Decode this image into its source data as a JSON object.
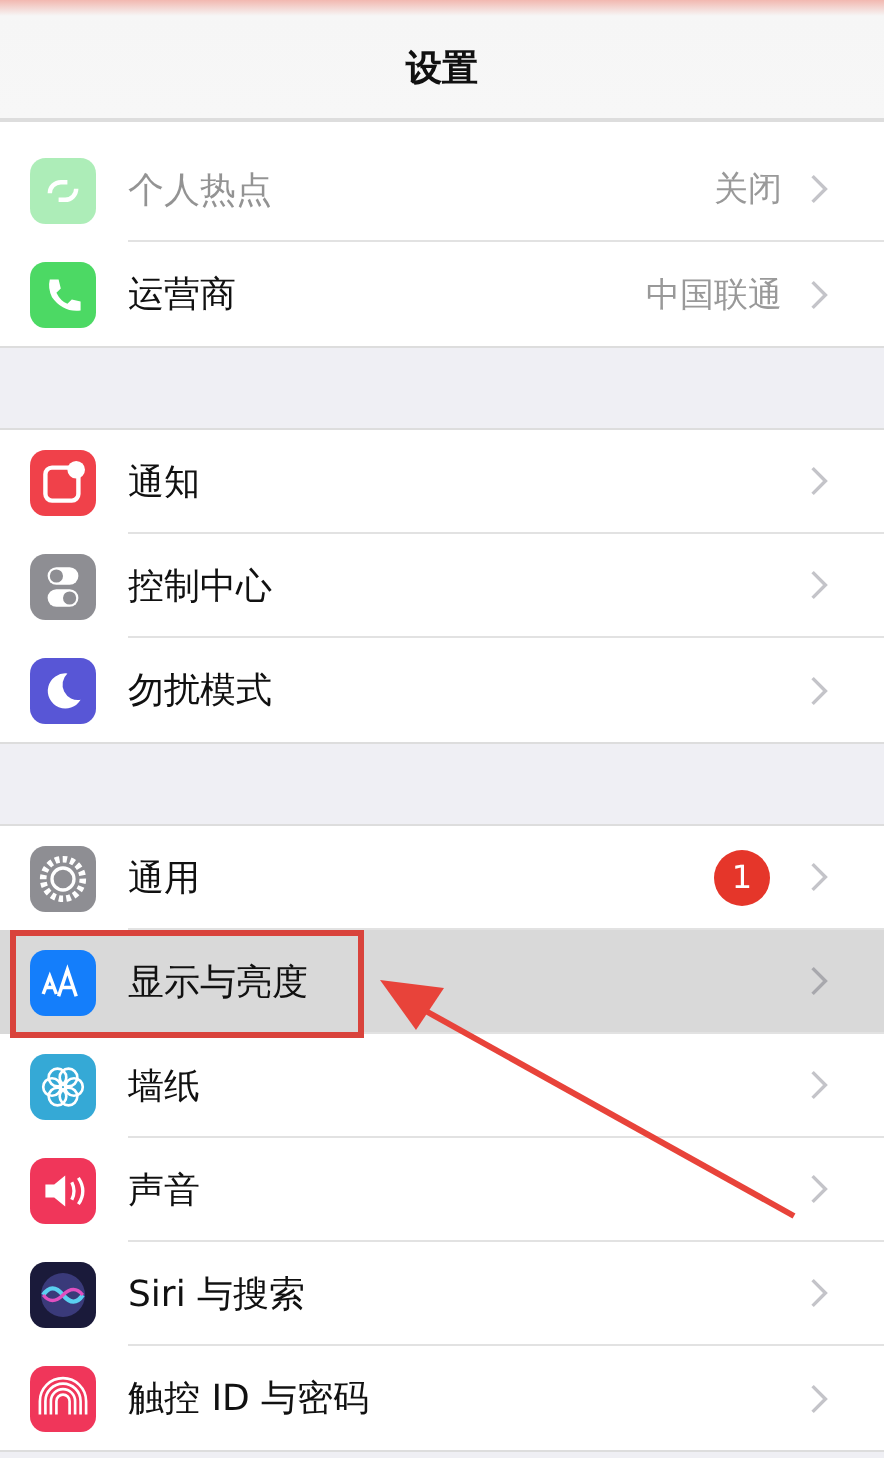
{
  "nav": {
    "title": "设置"
  },
  "groups": [
    {
      "rows": [
        {
          "label": "个人热点",
          "value": "关闭",
          "disabled": true,
          "selected": false
        },
        {
          "label": "运营商",
          "value": "中国联通",
          "disabled": false,
          "selected": false
        }
      ]
    },
    {
      "rows": [
        {
          "label": "通知",
          "disabled": false,
          "selected": false
        },
        {
          "label": "控制中心",
          "disabled": false,
          "selected": false
        },
        {
          "label": "勿扰模式",
          "disabled": false,
          "selected": false
        }
      ]
    },
    {
      "rows": [
        {
          "label": "通用",
          "badge": "1",
          "disabled": false,
          "selected": false
        },
        {
          "label": "显示与亮度",
          "disabled": false,
          "selected": true
        },
        {
          "label": "墙纸",
          "disabled": false,
          "selected": false
        },
        {
          "label": "声音",
          "disabled": false,
          "selected": false
        },
        {
          "label": "Siri 与搜索",
          "disabled": false,
          "selected": false
        },
        {
          "label": "触控 ID 与密码",
          "disabled": false,
          "selected": false
        }
      ]
    }
  ]
}
